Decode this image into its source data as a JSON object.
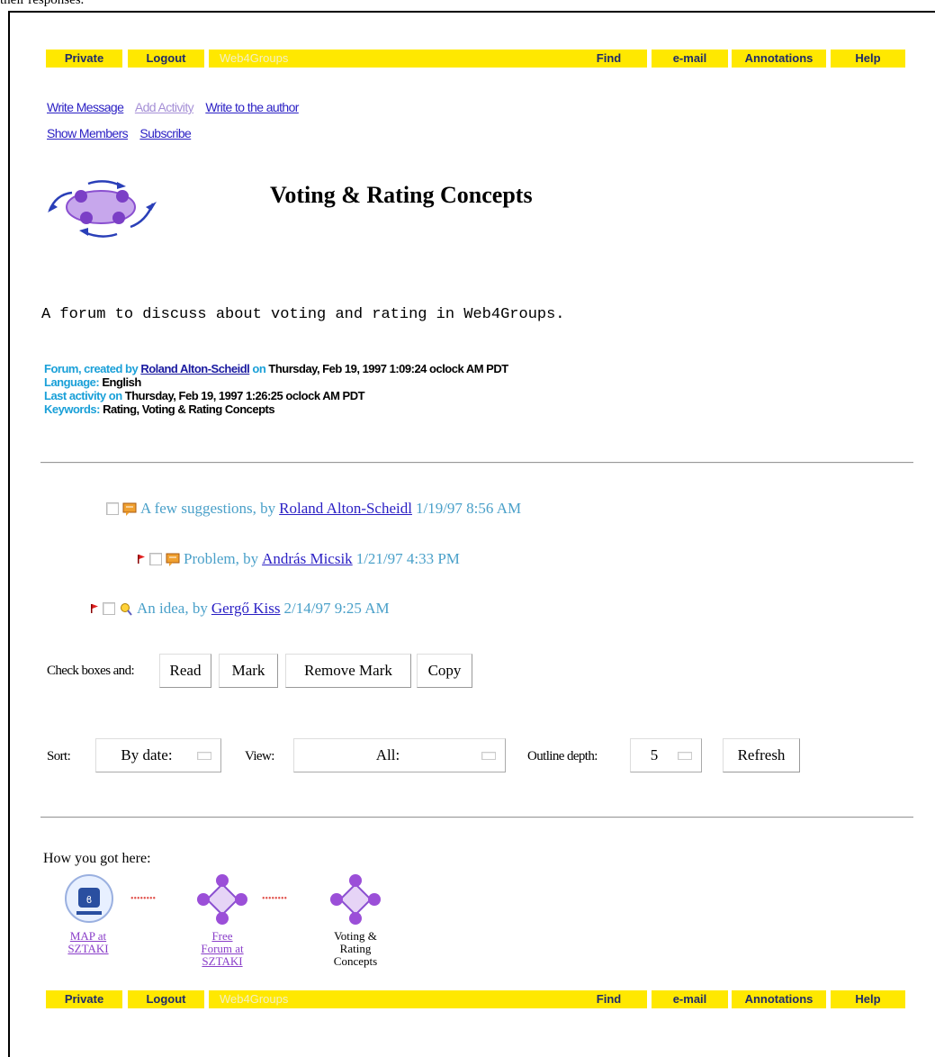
{
  "caption": "their responses.",
  "navbar": {
    "private": "Private",
    "logout": "Logout",
    "web4groups": "Web4Groups",
    "find": "Find",
    "email": "e-mail",
    "annotations": "Annotations",
    "help": "Help"
  },
  "links": {
    "write_message": "Write Message",
    "add_activity": "Add Activity",
    "write_author": "Write to the author",
    "show_members": "Show Members",
    "subscribe": "Subscribe"
  },
  "title": "Voting & Rating Concepts",
  "description": "A forum to discuss about voting and rating in Web4Groups.",
  "meta": {
    "created_label": "Forum, created by ",
    "creator": "Roland Alton-Scheidl",
    "on_label": " on ",
    "created_date": "Thursday, Feb 19, 1997 1:09:24 oclock AM PDT",
    "language_label": "Language: ",
    "language": "English",
    "activity_label": "Last activity on ",
    "activity_date": "Thursday, Feb 19, 1997 1:26:25 oclock AM PDT",
    "keywords_label": "Keywords: ",
    "keywords": "Rating, Voting & Rating Concepts"
  },
  "messages": [
    {
      "title": "A few suggestions, by ",
      "author": "Roland Alton-Scheidl",
      "date": "1/19/97 8:56 AM"
    },
    {
      "title": "Problem, by ",
      "author": "András Micsik",
      "date": "1/21/97 4:33 PM"
    },
    {
      "title": "An idea, by ",
      "author": "Gergő Kiss",
      "date": "2/14/97 9:25 AM"
    }
  ],
  "actions": {
    "label": "Check boxes and:",
    "read": "Read",
    "mark": "Mark",
    "remove_mark": "Remove Mark",
    "copy": "Copy"
  },
  "controls": {
    "sort_label": "Sort:",
    "sort_value": "By date:",
    "view_label": "View:",
    "view_value": "All:",
    "depth_label": "Outline depth:",
    "depth_value": "5",
    "refresh": "Refresh"
  },
  "breadcrumb": {
    "label": "How you got here:",
    "dots": "••••••••",
    "items": [
      {
        "line1": "MAP at",
        "line2": "SZTAKI",
        "line3": ""
      },
      {
        "line1": "Free",
        "line2": "Forum at",
        "line3": "SZTAKI"
      },
      {
        "line1": "Voting &",
        "line2": "Rating",
        "line3": "Concepts"
      }
    ]
  },
  "colors": {
    "navbar_bg": "#ffe800",
    "navbar_text": "#1f2b6a",
    "link": "#2a1fc4",
    "message_text": "#4aa0c9",
    "label_blue": "#1aa0d8"
  }
}
